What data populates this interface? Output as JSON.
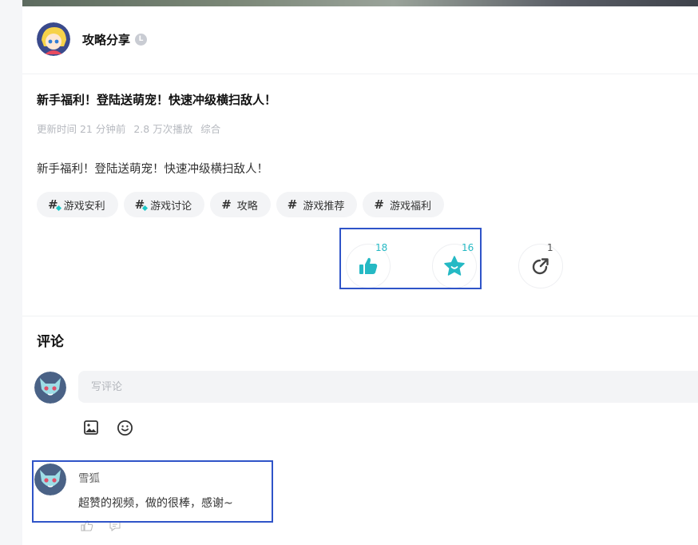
{
  "author": {
    "name": "攻略分享",
    "badge": "L"
  },
  "post": {
    "title": "新手福利！登陆送萌宠！快速冲级横扫敌人！",
    "meta": {
      "updated": "更新时间 21 分钟前",
      "plays": "2.8 万次播放",
      "category": "综合"
    },
    "description": "新手福利！登陆送萌宠！快速冲级横扫敌人！",
    "tags": [
      {
        "label": "游戏安利",
        "icon": "hash-sparkle-icon"
      },
      {
        "label": "游戏讨论",
        "icon": "hash-sparkle-icon"
      },
      {
        "label": "攻略",
        "icon": "hash-icon"
      },
      {
        "label": "游戏推荐",
        "icon": "hash-icon"
      },
      {
        "label": "游戏福利",
        "icon": "hash-icon"
      }
    ]
  },
  "actions": {
    "like": {
      "count": "18",
      "icon": "thumbs-up-icon"
    },
    "favorite": {
      "count": "16",
      "icon": "star-icon"
    },
    "share": {
      "count": "1",
      "icon": "share-icon"
    }
  },
  "comments": {
    "title": "评论",
    "input_placeholder": "写评论",
    "toolbar": [
      "image-icon",
      "emoji-icon"
    ],
    "items": [
      {
        "user": "雪狐",
        "text": "超赞的视频，做的很棒，感谢~",
        "actions": [
          "like-icon",
          "reply-icon"
        ]
      }
    ]
  },
  "colors": {
    "accent": "#25b9c4",
    "highlight": "#2f54c8",
    "background": "#f5f6f8"
  }
}
